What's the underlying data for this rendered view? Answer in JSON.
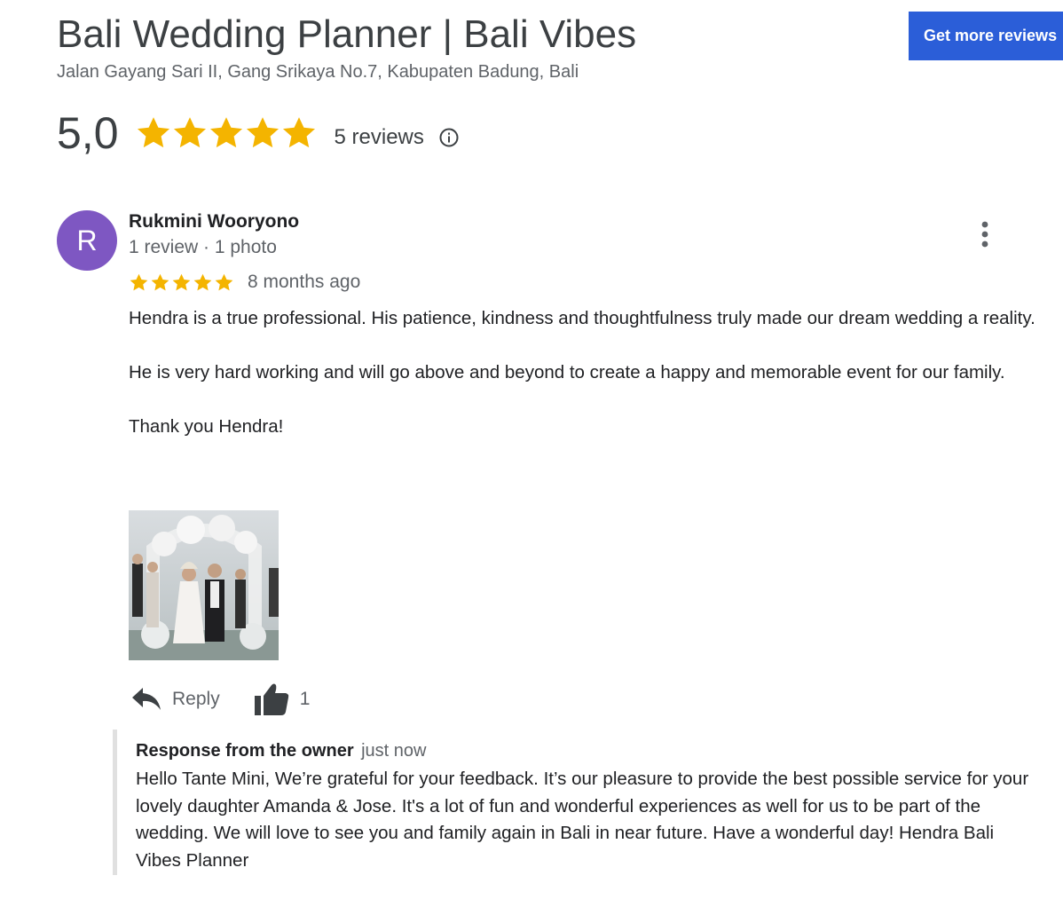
{
  "business": {
    "title": "Bali Wedding Planner | Bali Vibes",
    "address": "Jalan Gayang Sari II, Gang Srikaya No.7, Kabupaten Badung, Bali"
  },
  "header": {
    "get_more_label": "Get more reviews"
  },
  "summary": {
    "rating": "5,0",
    "stars": 5,
    "reviews_label": "5 reviews"
  },
  "review": {
    "avatar_letter": "R",
    "reviewer_name": "Rukmini Wooryono",
    "reviewer_meta": "1 review · 1 photo",
    "stars": 5,
    "time": "8 months ago",
    "paragraphs": [
      "Hendra is a true professional. His patience, kindness and thoughtfulness truly made our dream wedding a reality.",
      "He is very hard working and will go above and beyond to create a happy and memorable event for our family.",
      "Thank you Hendra!"
    ],
    "reply_label": "Reply",
    "like_count": "1"
  },
  "owner_response": {
    "title": "Response from the owner",
    "time": "just now",
    "text": "Hello Tante Mini, We’re grateful for your feedback. It’s our pleasure to provide the best possible service for your lovely daughter Amanda & Jose. It's a lot of fun and wonderful experiences as well for us to be part of the wedding. We will love to see you and family again in Bali in near future. Have a wonderful day! Hendra Bali Vibes Planner"
  },
  "colors": {
    "star": "#f4b400",
    "button": "#2b5ed8",
    "avatar": "#7e57c2"
  }
}
